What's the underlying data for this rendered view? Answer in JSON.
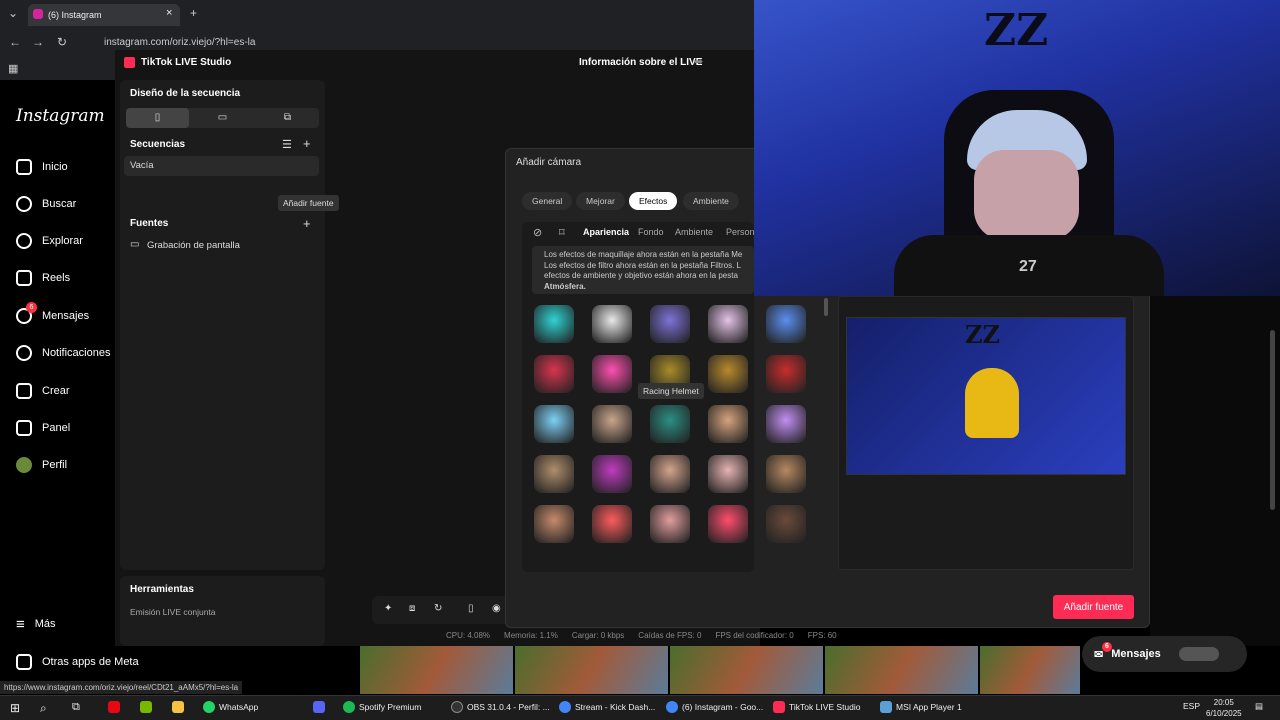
{
  "browser": {
    "tab_title": "(6) Instagram",
    "address": "instagram.com/oriz.viejo/?hl=es-la",
    "status_url": "https://www.instagram.com/oriz.viejo/reel/CDt21_aAMx5/?hl=es-la"
  },
  "instagram": {
    "logo": "Instagram",
    "nav": [
      "Inicio",
      "Buscar",
      "Explorar",
      "Reels",
      "Mensajes",
      "Notificaciones",
      "Crear",
      "Panel",
      "Perfil"
    ],
    "more": "Más",
    "meta_apps": "Otras apps de Meta",
    "messages_badge": "6",
    "messages_bar_label": "Mensajes",
    "messages_bar_badge": "6"
  },
  "studio": {
    "app_title": "TikTok LIVE Studio",
    "live_info": "Información sobre el LIVE",
    "layout_title": "Diseño de la secuencia",
    "sequences_title": "Secuencias",
    "sequence_item": "Vacía",
    "sources_title": "Fuentes",
    "add_source_tooltip": "Añadir fuente",
    "source_item": "Grabación de pantalla",
    "tools_title": "Herramientas",
    "joint_live": "Emisión LIVE conjunta",
    "stats": {
      "cpu": "CPU:  4.08%",
      "memory": "Memoria:  1.1%",
      "load": "Cargar:  0 kbps",
      "fps_drops": "Caídas de FPS:  0",
      "encoder_fps": "FPS del codificador:  0",
      "fps": "FPS:  60"
    }
  },
  "dialog": {
    "title": "Añadir cámara",
    "tabs": [
      "General",
      "Mejorar",
      "Efectos",
      "Ambiente"
    ],
    "active_tab": "Efectos",
    "subtabs": [
      "Apariencia",
      "Fondo",
      "Ambiente",
      "Persona"
    ],
    "info_line1": "Los efectos de maquillaje ahora están en la pestaña Me",
    "info_line2": "Los efectos de filtro ahora están en la pestaña Filtros. L",
    "info_line3": "efectos de ambiente y objetivo están ahora en la pesta",
    "info_line4": "Atmósfera.",
    "hover_tooltip": "Racing Helmet",
    "add_button": "Añadir fuente"
  },
  "taskbar": {
    "items": [
      "WhatsApp",
      "Spotify Premium",
      "OBS 31.0.4 - Perfil: ...",
      "Stream - Kick Dash...",
      "(6) Instagram - Goo...",
      "TikTok LIVE Studio",
      "MSI App Player 1"
    ],
    "lang": "ESP",
    "time": "20:05",
    "date": "6/10/2025"
  },
  "colors": {
    "accent": "#fe2c55",
    "studio_bg": "#141414",
    "webcam_blue": "#2b3fbf"
  },
  "webcam": {
    "wall_logo": "ZZ",
    "shirt_number": "27"
  }
}
